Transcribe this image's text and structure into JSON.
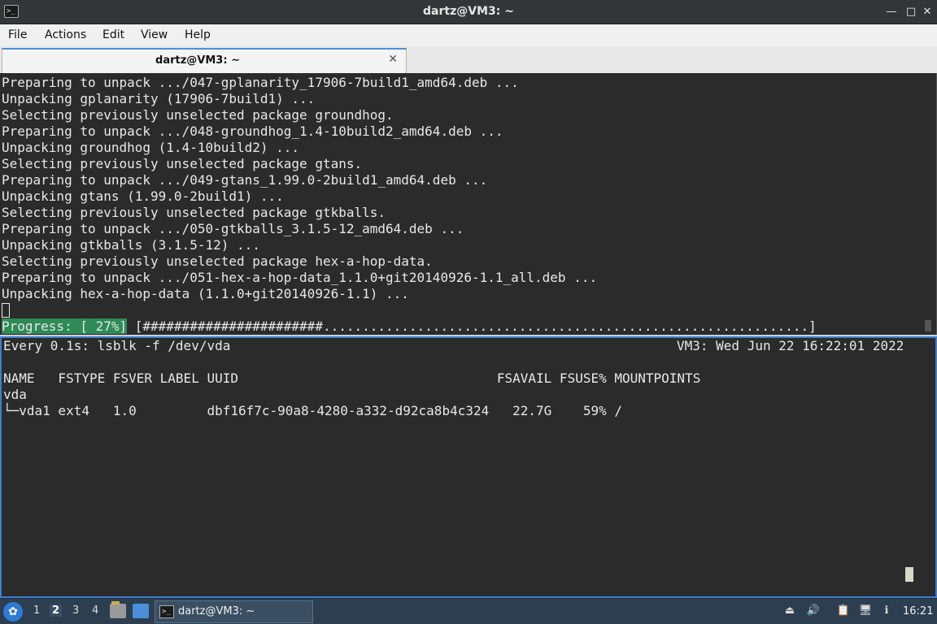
{
  "window": {
    "title": "dartz@VM3: ~",
    "app_icon": ">_",
    "minimize": "—",
    "maximize": "□",
    "close": "✕"
  },
  "menu": [
    "File",
    "Actions",
    "Edit",
    "View",
    "Help"
  ],
  "tab": {
    "label": "dartz@VM3: ~",
    "close": "✕"
  },
  "top_pane": {
    "lines": [
      "Preparing to unpack .../047-gplanarity_17906-7build1_amd64.deb ...",
      "Unpacking gplanarity (17906-7build1) ...",
      "Selecting previously unselected package groundhog.",
      "Preparing to unpack .../048-groundhog_1.4-10build2_amd64.deb ...",
      "Unpacking groundhog (1.4-10build2) ...",
      "Selecting previously unselected package gtans.",
      "Preparing to unpack .../049-gtans_1.99.0-2build1_amd64.deb ...",
      "Unpacking gtans (1.99.0-2build1) ...",
      "Selecting previously unselected package gtkballs.",
      "Preparing to unpack .../050-gtkballs_3.1.5-12_amd64.deb ...",
      "Unpacking gtkballs (3.1.5-12) ...",
      "Selecting previously unselected package hex-a-hop-data.",
      "Preparing to unpack .../051-hex-a-hop-data_1.1.0+git20140926-1.1_all.deb ...",
      "Unpacking hex-a-hop-data (1.1.0+git20140926-1.1) ..."
    ],
    "progress_label": "Progress: [ 27%]",
    "progress_bar": " [#######################..............................................................]"
  },
  "bottom_pane": {
    "header_left": "Every 0.1s: lsblk -f /dev/vda",
    "header_right": "VM3: Wed Jun 22 16:22:01 2022",
    "columns_line": "NAME   FSTYPE FSVER LABEL UUID                                 FSAVAIL FSUSE% MOUNTPOINTS",
    "rows": [
      "vda",
      "└─vda1 ext4   1.0         dbf16f7c-90a8-4280-a332-d92ca8b4c324   22.7G    59% /"
    ]
  },
  "taskbar": {
    "start_icon": "start-menu-icon",
    "workspaces": [
      "1",
      "2",
      "3",
      "4"
    ],
    "active_workspace": "2",
    "task_label": "dartz@VM3: ~",
    "clock": "16:21"
  }
}
